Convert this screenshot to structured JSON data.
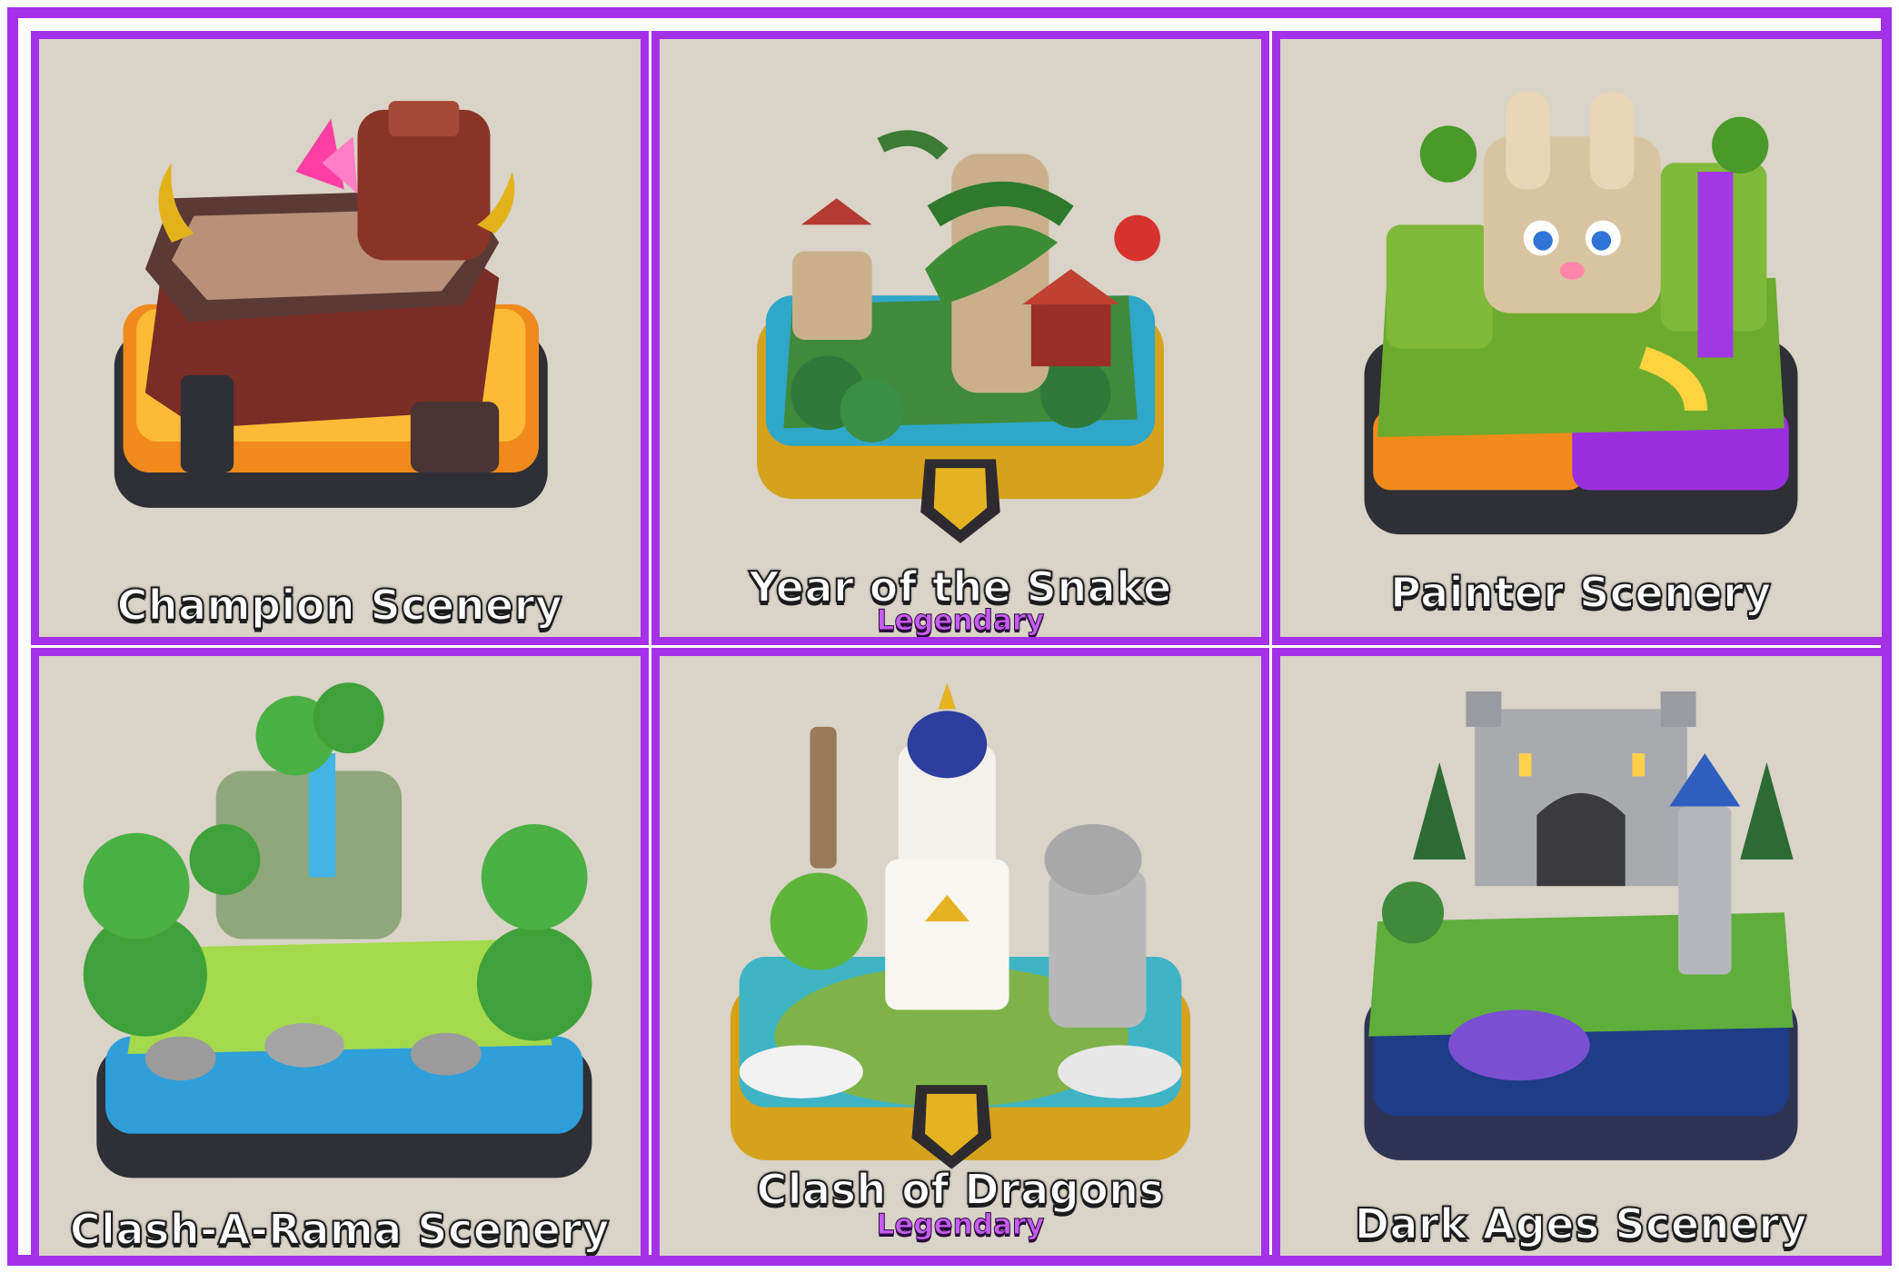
{
  "colors": {
    "border": "#a431e8",
    "tile_background": "#d9d3c8",
    "legendary_text": "#c65cf0"
  },
  "sceneries": [
    {
      "name": "Champion Scenery",
      "rarity": "",
      "icon": "champion-lava-arena-icon"
    },
    {
      "name": "Year of the Snake",
      "rarity": "Legendary",
      "icon": "snake-temple-arena-icon"
    },
    {
      "name": "Painter Scenery",
      "rarity": "",
      "icon": "painter-bunny-arena-icon"
    },
    {
      "name": "Clash-A-Rama Scenery",
      "rarity": "",
      "icon": "forest-waterfall-arena-icon"
    },
    {
      "name": "Clash of Dragons",
      "rarity": "Legendary",
      "icon": "dragon-temple-arena-icon"
    },
    {
      "name": "Dark Ages Scenery",
      "rarity": "",
      "icon": "castle-arena-icon"
    }
  ]
}
